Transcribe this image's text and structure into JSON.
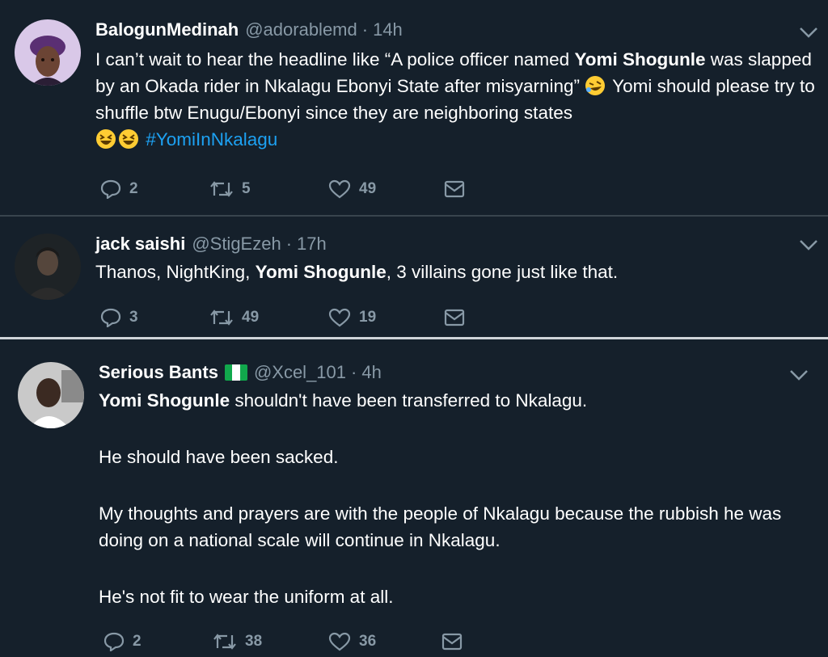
{
  "tweets": [
    {
      "name": "BalogunMedinah",
      "handle": "@adorablemd",
      "sep": "·",
      "time": "14h",
      "text_a": "I can’t wait to hear the headline like “A police officer named ",
      "bold_a": "Yomi Shogunle",
      "text_b": " was slapped by an Okada rider in Nkalagu Ebonyi State after misyarning” ",
      "text_c": " Yomi should please try to shuffle btw Enugu/Ebonyi since they are neighboring states ",
      "hashtag": "#YomiInNkalagu",
      "replies": "2",
      "retweets": "5",
      "likes": "49"
    },
    {
      "name": "jack saishi",
      "handle": "@StigEzeh",
      "sep": "·",
      "time": "17h",
      "text_a": "Thanos, NightKing, ",
      "bold_a": "Yomi Shogunle",
      "text_b": ", 3 villains gone just like that.",
      "replies": "3",
      "retweets": "49",
      "likes": "19"
    },
    {
      "name": "Serious Bants",
      "handle": "@Xcel_101",
      "sep": "·",
      "time": "4h",
      "bold_a": "Yomi Shogunle",
      "text_a": " shouldn't have been transferred to Nkalagu.",
      "para2": "He should have been sacked.",
      "para3": "My thoughts and prayers are with the people of Nkalagu because the rubbish he was doing on a national scale will continue in Nkalagu.",
      "para4": "He's not fit to wear the uniform at all.",
      "replies": "2",
      "retweets": "38",
      "likes": "36"
    }
  ],
  "colors": {
    "background": "#15202b",
    "muted": "#8899a6",
    "link": "#1da1f2",
    "divider": "#38444d"
  },
  "icons": [
    "reply-icon",
    "retweet-icon",
    "like-icon",
    "dm-icon",
    "chevron-down-icon",
    "nigeria-flag-icon",
    "rofl-emoji",
    "grinning-squint-emoji"
  ]
}
